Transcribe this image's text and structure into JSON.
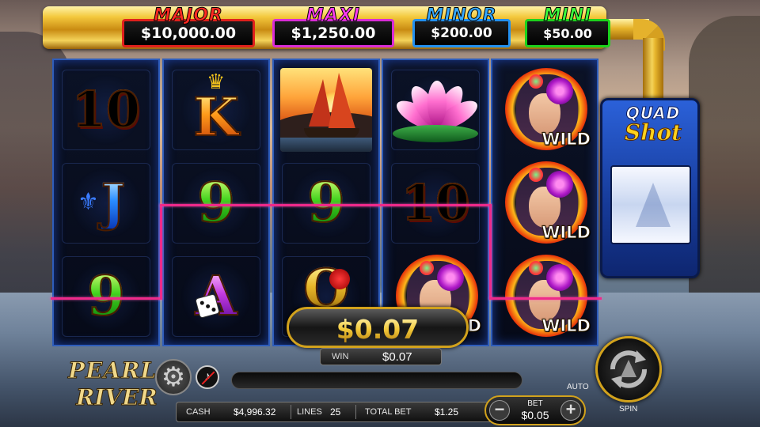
{
  "jackpots": {
    "major": {
      "label": "MAJOR",
      "value": "$10,000.00"
    },
    "maxi": {
      "label": "MAXI",
      "value": "$1,250.00"
    },
    "minor": {
      "label": "MINOR",
      "value": "$200.00"
    },
    "mini": {
      "label": "MINI",
      "value": "$50.00"
    }
  },
  "reels": [
    {
      "symbols": [
        "10",
        "J",
        "9"
      ]
    },
    {
      "symbols": [
        "K",
        "9",
        "A"
      ]
    },
    {
      "symbols": [
        "junk-boat",
        "9",
        "Q"
      ]
    },
    {
      "symbols": [
        "lotus-flower",
        "10",
        "WILD"
      ]
    },
    {
      "symbols": [
        "WILD",
        "WILD",
        "WILD"
      ]
    }
  ],
  "wild_label": "WILD",
  "quad_shot": {
    "line1": "QUAD",
    "line2": "Shot"
  },
  "win": {
    "amount": "$0.07",
    "label": "WIN",
    "value": "$0.07"
  },
  "game_logo": {
    "line1": "PEARL",
    "line2": "RIVER"
  },
  "info": {
    "cash_label": "CASH",
    "cash_value": "$4,996.32",
    "lines_label": "LINES",
    "lines_value": "25",
    "total_bet_label": "TOTAL BET",
    "total_bet_value": "$1.25"
  },
  "bet": {
    "label": "BET",
    "value": "$0.05",
    "minus": "−",
    "plus": "+"
  },
  "auto_label": "AUTO",
  "spin_label": "SPIN",
  "colors": {
    "payline": "#ee2a8a",
    "gold_trim": "#d2a21c",
    "reel_border": "#2e5dbb"
  },
  "icons": {
    "settings": "gear-icon",
    "sound": "sound-muted-icon",
    "spin": "spin-arrows-icon"
  }
}
